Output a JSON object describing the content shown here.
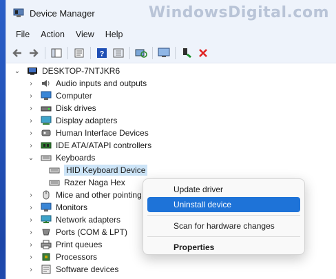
{
  "window": {
    "title": "Device Manager",
    "watermark": "WindowsDigital.com"
  },
  "menubar": {
    "items": [
      "File",
      "Action",
      "View",
      "Help"
    ]
  },
  "toolbar": {
    "icons": [
      "back-arrow-icon",
      "forward-arrow-icon",
      "show-hide-tree-icon",
      "properties-icon",
      "help-icon",
      "update-driver-icon",
      "scan-hardware-icon",
      "enable-device-icon",
      "uninstall-device-icon"
    ]
  },
  "tree": {
    "root": "DESKTOP-7NTJKR6",
    "categories": [
      "Audio inputs and outputs",
      "Computer",
      "Disk drives",
      "Display adapters",
      "Human Interface Devices",
      "IDE ATA/ATAPI controllers",
      "Keyboards",
      "Mice and other pointing devices",
      "Monitors",
      "Network adapters",
      "Ports (COM & LPT)",
      "Print queues",
      "Processors",
      "Software devices"
    ],
    "keyboards_children": [
      "HID Keyboard Device",
      "Razer Naga Hex"
    ]
  },
  "context_menu": {
    "update_driver": "Update driver",
    "uninstall_device": "Uninstall device",
    "scan_hardware": "Scan for hardware changes",
    "properties": "Properties"
  },
  "colors": {
    "selection": "#cce4f7",
    "menu_highlight": "#1e73d8",
    "uninstall_red": "#e02020"
  }
}
